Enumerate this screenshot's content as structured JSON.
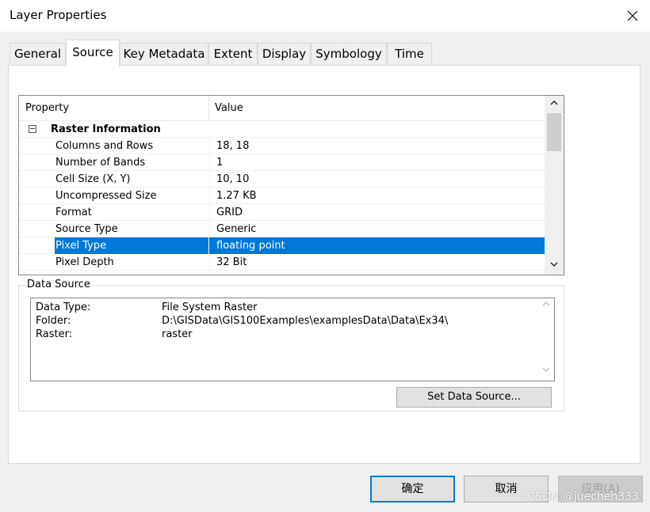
{
  "window": {
    "title": "Layer Properties"
  },
  "tabs": [
    {
      "label": "General"
    },
    {
      "label": "Source"
    },
    {
      "label": "Key Metadata"
    },
    {
      "label": "Extent"
    },
    {
      "label": "Display"
    },
    {
      "label": "Symbology"
    },
    {
      "label": "Time"
    }
  ],
  "active_tab": "Source",
  "property_grid": {
    "header_property": "Property",
    "header_value": "Value",
    "group": "Raster Information",
    "rows": [
      {
        "property": "Columns and Rows",
        "value": "18, 18"
      },
      {
        "property": "Number of Bands",
        "value": "1"
      },
      {
        "property": "Cell Size (X, Y)",
        "value": "10, 10"
      },
      {
        "property": "Uncompressed Size",
        "value": "1.27 KB"
      },
      {
        "property": "Format",
        "value": "GRID"
      },
      {
        "property": "Source Type",
        "value": "Generic"
      },
      {
        "property": "Pixel Type",
        "value": "floating point"
      },
      {
        "property": "Pixel Depth",
        "value": "32 Bit"
      }
    ],
    "selected_row": "Pixel Type"
  },
  "data_source": {
    "label": "Data Source",
    "entries": [
      {
        "key": "Data Type:",
        "value": "File System Raster"
      },
      {
        "key": "Folder:",
        "value": "D:\\GISData\\GIS100Examples\\examplesData\\Data\\Ex34\\"
      },
      {
        "key": "Raster:",
        "value": "raster"
      }
    ],
    "set_button": "Set Data Source..."
  },
  "footer": {
    "ok": "确定",
    "cancel": "取消",
    "apply": "应用(A)"
  },
  "watermark": "CSDN @juechen333",
  "colors": {
    "selection": "#0078d7",
    "default_button_border": "#0078d7"
  }
}
